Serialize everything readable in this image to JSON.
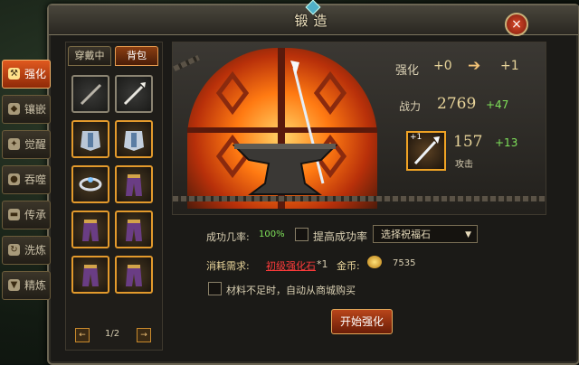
{
  "window": {
    "title": "锻造",
    "close_label": "×"
  },
  "side_tabs": [
    {
      "label": "强化",
      "icon": "hammer-icon"
    },
    {
      "label": "镶嵌",
      "icon": "gem-icon"
    },
    {
      "label": "觉醒",
      "icon": "eye-icon"
    },
    {
      "label": "吞噬",
      "icon": "orb-icon"
    },
    {
      "label": "传承",
      "icon": "scroll-icon"
    },
    {
      "label": "洗炼",
      "icon": "refine-icon"
    },
    {
      "label": "精炼",
      "icon": "anvil-icon"
    }
  ],
  "inventory": {
    "tabs": [
      "穿戴中",
      "背包"
    ],
    "page": "1/2",
    "prev_label": "←",
    "next_label": "→"
  },
  "forge": {
    "enhance_label": "强化",
    "level_from": "+0",
    "level_to": "+1",
    "power_label": "战力",
    "power_value": "2769",
    "power_gain": "+47",
    "item_badge": "+1",
    "attack_value": "157",
    "attack_gain": "+13",
    "attack_label": "攻击"
  },
  "options": {
    "success_label": "成功几率:",
    "success_value": "100%",
    "improve_label": "提高成功率",
    "select_value": "选择祝福石",
    "cost_label": "消耗需求:",
    "material_name": "初级强化石",
    "material_count": "*1",
    "gold_label": "金币:",
    "gold_value": "7535",
    "auto_buy_label": "材料不足时，自动从商城购买",
    "start_button": "开始强化"
  },
  "colors": {
    "accent": "#e0591f",
    "gain": "#7fe25a",
    "material": "#ff3b3b"
  }
}
